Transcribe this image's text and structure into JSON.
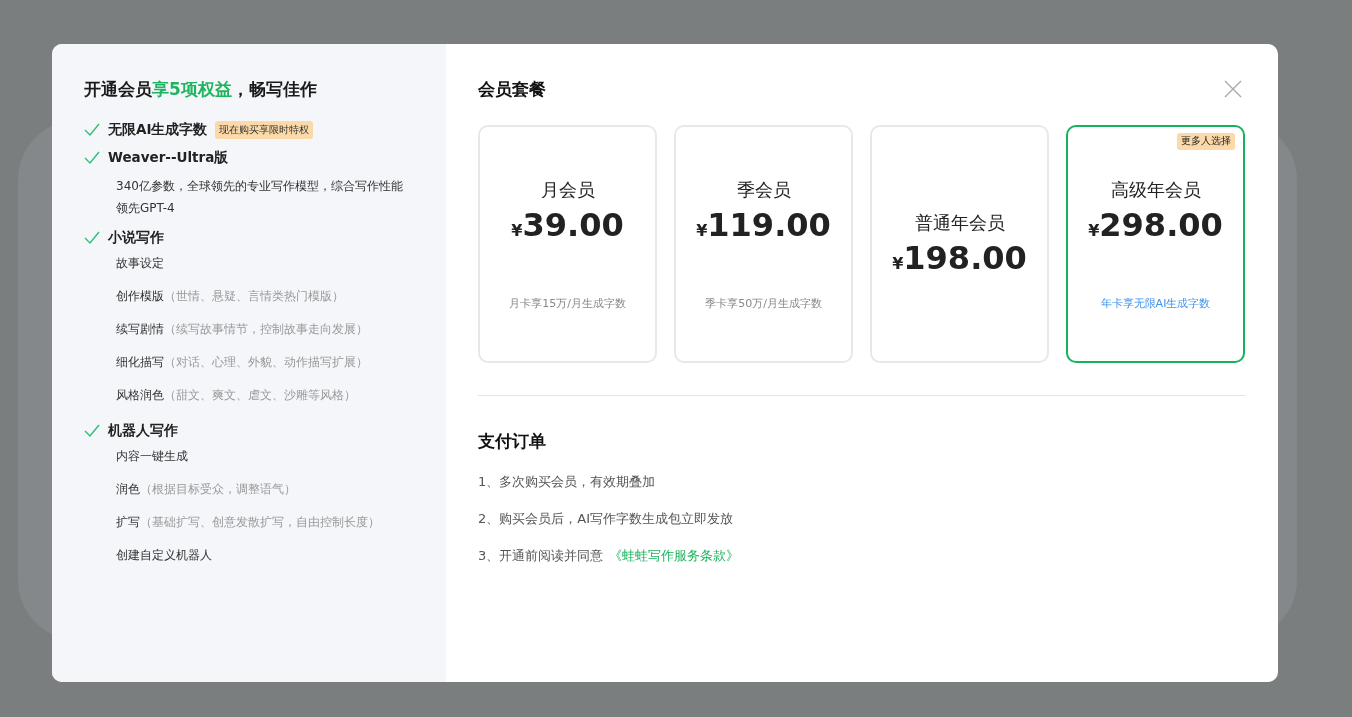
{
  "benefits": {
    "title": {
      "lead": "开通会员",
      "highlight": "享5项权益",
      "tail": "，畅写佳作"
    },
    "items": [
      {
        "label": "无限AI生成字数",
        "badge": "现在购买享限时特权"
      },
      {
        "label": "Weaver--Ultra版",
        "children": [
          {
            "kind": "description",
            "label": "340亿参数，全球领先的专业写作模型，综合写作性能领先GPT-4"
          }
        ]
      },
      {
        "label": "小说写作",
        "children": [
          {
            "kind": "feature",
            "label": "故事设定"
          },
          {
            "kind": "feature",
            "label": "创作模版",
            "note": "（世情、悬疑、言情类热门模版）"
          },
          {
            "kind": "feature",
            "label": "续写剧情",
            "note": "（续写故事情节，控制故事走向发展）"
          },
          {
            "kind": "feature",
            "label": "细化描写",
            "note": "（对话、心理、外貌、动作描写扩展）"
          },
          {
            "kind": "feature",
            "label": "风格润色",
            "note": "（甜文、爽文、虐文、沙雕等风格）"
          }
        ]
      },
      {
        "label": "机器人写作",
        "children": [
          {
            "kind": "feature",
            "label": "内容一键生成"
          },
          {
            "kind": "feature",
            "label": "润色",
            "note": "（根据目标受众，调整语气）"
          },
          {
            "kind": "feature",
            "label": "扩写",
            "note": "（基础扩写、创意发散扩写，自由控制长度）"
          },
          {
            "kind": "feature",
            "label": "创建自定义机器人"
          }
        ]
      }
    ]
  },
  "plans": {
    "title": "会员套餐",
    "items": [
      {
        "name": "月会员",
        "currency": "¥",
        "price": "39.00",
        "note": "月卡享15万/月生成字数",
        "selected": false
      },
      {
        "name": "季会员",
        "currency": "¥",
        "price": "119.00",
        "note": "季卡享50万/月生成字数",
        "selected": false
      },
      {
        "name": "普通年会员",
        "currency": "¥",
        "price": "198.00",
        "selected": false
      },
      {
        "name": "高级年会员",
        "currency": "¥",
        "price": "298.00",
        "note": "年卡享无限AI生成字数",
        "badge": "更多人选择",
        "selected": true
      }
    ]
  },
  "order": {
    "title": "支付订单",
    "lines": [
      {
        "text": "1、多次购买会员，有效期叠加"
      },
      {
        "text": "2、购买会员后，AI写作字数生成包立即发放"
      },
      {
        "text": "3、开通前阅读并同意",
        "link": "《蛙蛙写作服务条款》"
      }
    ]
  }
}
